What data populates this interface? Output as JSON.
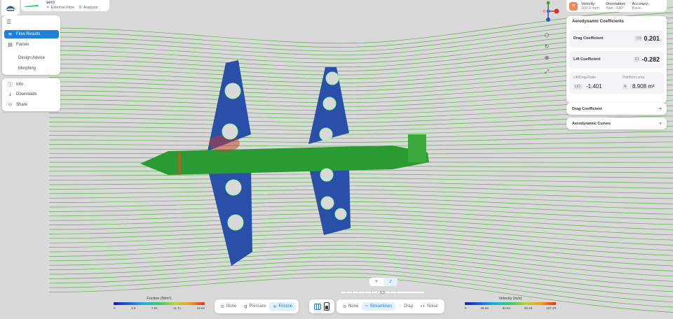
{
  "project": {
    "name": "aero",
    "tags": [
      "External Flow",
      "Analysis"
    ]
  },
  "nav": {
    "items": [
      {
        "label": "Flow Results",
        "icon": "flow-icon",
        "active": true
      },
      {
        "label": "Forces",
        "icon": "forces-icon",
        "active": false
      },
      {
        "label": "Design Advice",
        "icon": "",
        "active": false
      },
      {
        "label": "Morphing",
        "icon": "",
        "active": false
      }
    ],
    "bottom_items": [
      {
        "label": "Info",
        "icon": "info-icon"
      },
      {
        "label": "Downloads",
        "icon": "download-icon"
      },
      {
        "label": "Share",
        "icon": "share-icon"
      }
    ]
  },
  "conditions": {
    "velocity_label": "Velocity:",
    "velocity_value": "160.0 mph",
    "orientation_label": "Orientation:",
    "orientation_value": "Yaw: -180°",
    "accuracy_label": "Accuracy:",
    "accuracy_value": "Basic"
  },
  "coefficients": {
    "title": "Aerodynamic Coefficients",
    "drag_label": "Drag Coefficient",
    "drag_badge": "Cd",
    "drag_value": "0.201",
    "lift_label": "Lift Coefficient",
    "lift_badge": "Cl",
    "lift_value": "-0.282",
    "ld_label": "Lift/Drag Ratio",
    "ld_badge": "L/D",
    "ld_value": "-1.401",
    "area_label": "Planform area",
    "area_badge": "A",
    "area_value": "8.908 m²"
  },
  "dropdowns": {
    "drag": "Drag Coefficient",
    "curves": "Aerodynamic Curves"
  },
  "view_axes": {
    "y": "Y",
    "z": "Z",
    "active": "Z"
  },
  "slider": {
    "value": "0.3"
  },
  "surface_modes": {
    "options": [
      "None",
      "Pressure",
      "Friction"
    ],
    "active": "Friction"
  },
  "flow_modes": {
    "options": [
      "None",
      "Streamlines",
      "Drag",
      "Noise"
    ],
    "active": "Streamlines"
  },
  "friction_legend": {
    "title": "Friction (N/m²)",
    "ticks": [
      "0",
      "3.9",
      "7.81",
      "11.71",
      "15.62"
    ]
  },
  "velocity_legend": {
    "title": "Velocity (m/s)",
    "ticks": [
      "0",
      "26.82",
      "53.64",
      "80.46",
      "107.29"
    ]
  },
  "colors": {
    "accent": "#1f82d8",
    "streamline": "#3fa82a",
    "background": "#d9d9d9"
  }
}
